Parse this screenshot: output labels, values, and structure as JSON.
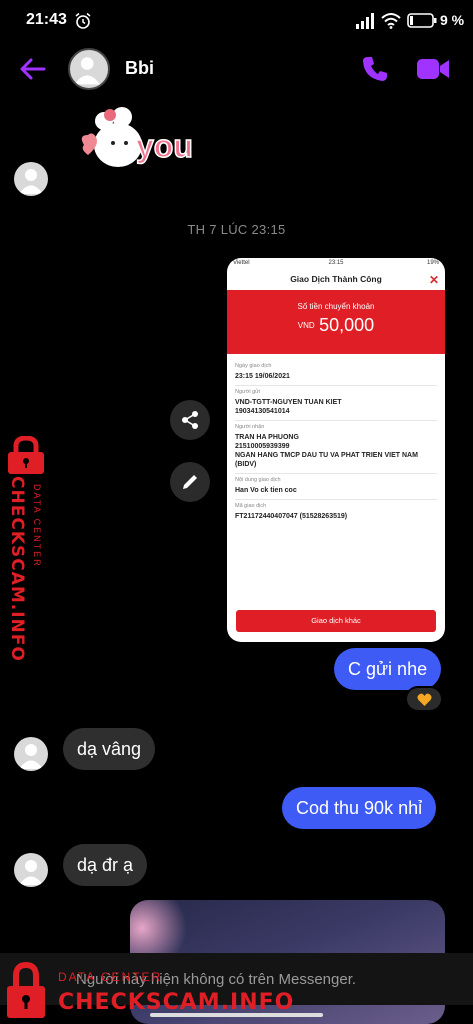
{
  "status_bar": {
    "time": "21:43",
    "battery_text": "9 %"
  },
  "header": {
    "contact_name": "Bbi",
    "icons": [
      "back-arrow-icon",
      "phone-icon",
      "video-camera-icon"
    ]
  },
  "colors": {
    "accent": "#a033ff",
    "outgoing_bubble": "#3e5bf5",
    "incoming_bubble": "#2f2f2f",
    "watermark": "#e01e25"
  },
  "messages": {
    "sticker_text": "you",
    "timestamp": "TH 7 LÚC 23:15",
    "out_1": "C gửi nhe",
    "in_1": "dạ vâng",
    "out_2": "Cod thu 90k nhỉ",
    "in_2": "dạ đr ạ",
    "reaction": "orange-heart-icon"
  },
  "receipt": {
    "carrier": "Viettel",
    "time": "23:15",
    "battery": "19%",
    "title": "Giao Dịch Thành Công",
    "banner_label": "Số tiền chuyển khoản",
    "currency": "VND",
    "amount": "50,000",
    "fields": [
      {
        "label": "Ngày giao dịch",
        "value": "23:15 19/06/2021"
      },
      {
        "label": "Người gửi",
        "value": "VND-TGTT-NGUYEN TUAN KIET",
        "value2": "19034130541014"
      },
      {
        "label": "Người nhận",
        "value": "TRAN HA PHUONG",
        "value2": "21510005939399",
        "value3": "NGAN HANG TMCP DAU TU VA PHAT TRIEN VIET NAM",
        "value4": "(BIDV)"
      },
      {
        "label": "Nội dung giao dịch",
        "value": "Han Vo ck tien coc"
      },
      {
        "label": "Mã giao dịch",
        "value": "FT21172440407047 (51528263519)"
      }
    ],
    "button_label": "Giao dịch khác"
  },
  "notice": {
    "text": "Người này hiện không có trên Messenger."
  },
  "watermark": {
    "title": "CHECKSCAM.INFO",
    "subtitle": "DATA CENTER"
  }
}
